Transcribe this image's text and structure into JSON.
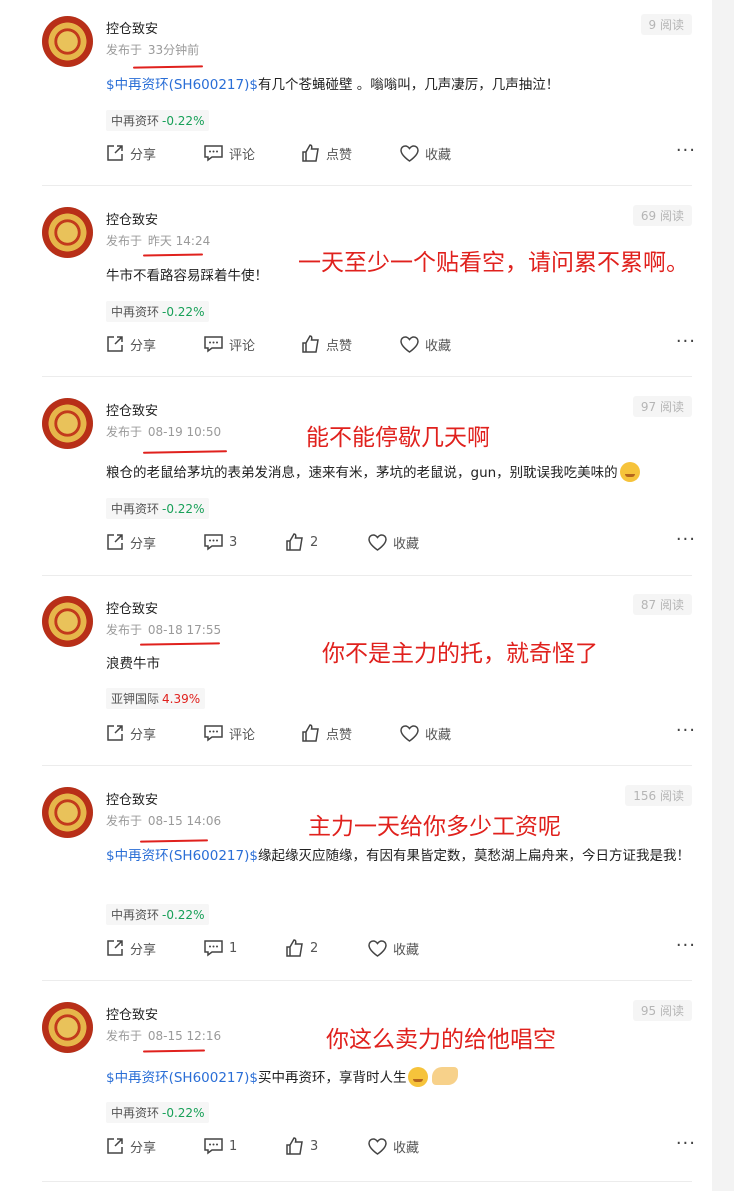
{
  "posts": [
    {
      "author": "控仓致安",
      "time_prefix": "发布于",
      "time": "33分钟前",
      "reads": "9 阅读",
      "stock_link": "$中再资环(SH600217)$",
      "text": "有几个苍蝇碰壁 。嗡嗡叫，几声凄厉，几声抽泣！",
      "tag_name": "中再资环",
      "tag_pct": "-0.22%",
      "tag_dir": "down",
      "share_label": "分享",
      "comment_label": "评论",
      "like_label": "点赞",
      "fav_label": "收藏",
      "annotation": ""
    },
    {
      "author": "控仓致安",
      "time_prefix": "发布于",
      "time": "昨天 14:24",
      "reads": "69 阅读",
      "stock_link": "",
      "text": "牛市不看路容易踩着牛使！",
      "tag_name": "中再资环",
      "tag_pct": "-0.22%",
      "tag_dir": "down",
      "share_label": "分享",
      "comment_label": "评论",
      "like_label": "点赞",
      "fav_label": "收藏",
      "annotation": "一天至少一个贴看空，请问累不累啊。"
    },
    {
      "author": "控仓致安",
      "time_prefix": "发布于",
      "time": "08-19 10:50",
      "reads": "97 阅读",
      "stock_link": "",
      "text": "粮仓的老鼠给茅坑的表弟发消息，速来有米，茅坑的老鼠说，gun，别耽误我吃美味的",
      "tag_name": "中再资环",
      "tag_pct": "-0.22%",
      "tag_dir": "down",
      "share_label": "分享",
      "comment_label": "3",
      "like_label": "2",
      "fav_label": "收藏",
      "annotation": "能不能停歇几天啊"
    },
    {
      "author": "控仓致安",
      "time_prefix": "发布于",
      "time": "08-18 17:55",
      "reads": "87 阅读",
      "stock_link": "",
      "text": "浪费牛市",
      "tag_name": "亚钾国际",
      "tag_pct": "4.39%",
      "tag_dir": "up",
      "share_label": "分享",
      "comment_label": "评论",
      "like_label": "点赞",
      "fav_label": "收藏",
      "annotation": "你不是主力的托，就奇怪了"
    },
    {
      "author": "控仓致安",
      "time_prefix": "发布于",
      "time": "08-15 14:06",
      "reads": "156 阅读",
      "stock_link": "$中再资环(SH600217)$",
      "text": "缘起缘灭应随缘，有因有果皆定数，莫愁湖上扁舟来，今日方证我是我！",
      "tag_name": "中再资环",
      "tag_pct": "-0.22%",
      "tag_dir": "down",
      "share_label": "分享",
      "comment_label": "1",
      "like_label": "2",
      "fav_label": "收藏",
      "annotation": "主力一天给你多少工资呢"
    },
    {
      "author": "控仓致安",
      "time_prefix": "发布于",
      "time": "08-15 12:16",
      "reads": "95 阅读",
      "stock_link": "$中再资环(SH600217)$",
      "text": "买中再资环，享背时人生",
      "tag_name": "中再资环",
      "tag_pct": "-0.22%",
      "tag_dir": "down",
      "share_label": "分享",
      "comment_label": "1",
      "like_label": "3",
      "fav_label": "收藏",
      "annotation": "你这么卖力的给他唱空"
    }
  ],
  "more_label": "···",
  "colors": {
    "link": "#2a6ed6",
    "down": "#18a058",
    "up": "#e0211d",
    "annotation": "#e0211d"
  },
  "icons": {
    "share": "share-icon",
    "comment": "comment-icon",
    "like": "thumbs-up-icon",
    "fav": "heart-icon",
    "more": "more-dots-icon"
  }
}
